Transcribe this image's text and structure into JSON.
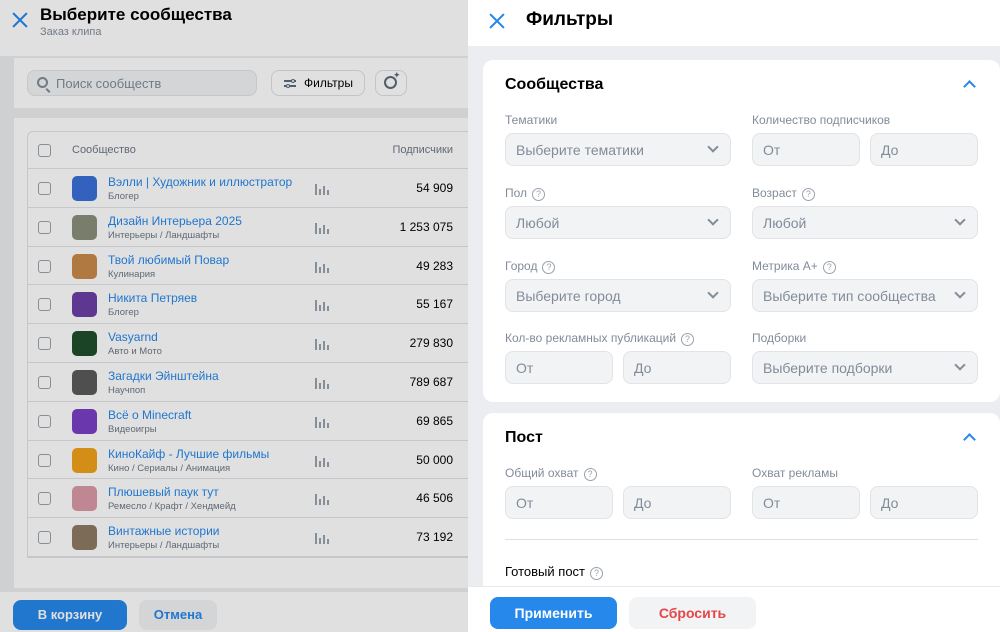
{
  "page": {
    "title": "Выберите сообщества",
    "subtitle": "Заказ клипа",
    "search_placeholder": "Поиск сообществ",
    "filters_label": "Фильтры",
    "columns": {
      "community": "Сообщество",
      "subscribers": "Подписчики"
    },
    "rows": [
      {
        "name": "Вэлли | Художник и иллюстратор",
        "category": "Блогер",
        "subscribers": "54 909",
        "avatar_color": "#3b6fd9"
      },
      {
        "name": "Дизайн Интерьера 2025",
        "category": "Интерьеры / Ландшафты",
        "subscribers": "1 253 075",
        "avatar_color": "#8a8f7c"
      },
      {
        "name": "Твой любимый Повар",
        "category": "Кулинария",
        "subscribers": "49 283",
        "avatar_color": "#c98a4b"
      },
      {
        "name": "Никита Петряев",
        "category": "Блогер",
        "subscribers": "55 167",
        "avatar_color": "#6b3fa6"
      },
      {
        "name": "Vasyarnd",
        "category": "Авто и Мото",
        "subscribers": "279 830",
        "avatar_color": "#1f4d2b"
      },
      {
        "name": "Загадки Эйнштейна",
        "category": "Научпоп",
        "subscribers": "789 687",
        "avatar_color": "#5a5a5a"
      },
      {
        "name": "Всё о Minecraft",
        "category": "Видеоигры",
        "subscribers": "69 865",
        "avatar_color": "#7a3fc4"
      },
      {
        "name": "КиноКайф - Лучшие фильмы",
        "category": "Кино / Сериалы / Анимация",
        "subscribers": "50 000",
        "avatar_color": "#f0a21b"
      },
      {
        "name": "Плюшевый паук тут",
        "category": "Ремесло / Крафт / Хендмейд",
        "subscribers": "46 506",
        "avatar_color": "#d99aa6"
      },
      {
        "name": "Винтажные истории",
        "category": "Интерьеры / Ландшафты",
        "subscribers": "73 192",
        "avatar_color": "#8d7a63"
      }
    ],
    "cart_button": "В корзину",
    "cancel_button": "Отмена"
  },
  "panel": {
    "title": "Фильтры",
    "communities": {
      "title": "Сообщества",
      "topics_label": "Тематики",
      "topics_placeholder": "Выберите тематики",
      "subscribers_label": "Количество подписчиков",
      "from": "От",
      "to": "До",
      "gender_label": "Пол",
      "gender_value": "Любой",
      "age_label": "Возраст",
      "age_value": "Любой",
      "city_label": "Город",
      "city_placeholder": "Выберите город",
      "metric_label": "Метрика A+",
      "metric_placeholder": "Выберите тип сообщества",
      "ads_label": "Кол-во рекламных публикаций",
      "collections_label": "Подборки",
      "collections_placeholder": "Выберите подборки"
    },
    "post": {
      "title": "Пост",
      "reach_label": "Общий охват",
      "ad_reach_label": "Охват рекламы",
      "ready_label": "Готовый пост"
    },
    "apply_button": "Применить",
    "reset_button": "Сбросить"
  },
  "colors": {
    "accent": "#2688eb",
    "danger": "#e64646",
    "muted": "#818c99"
  }
}
